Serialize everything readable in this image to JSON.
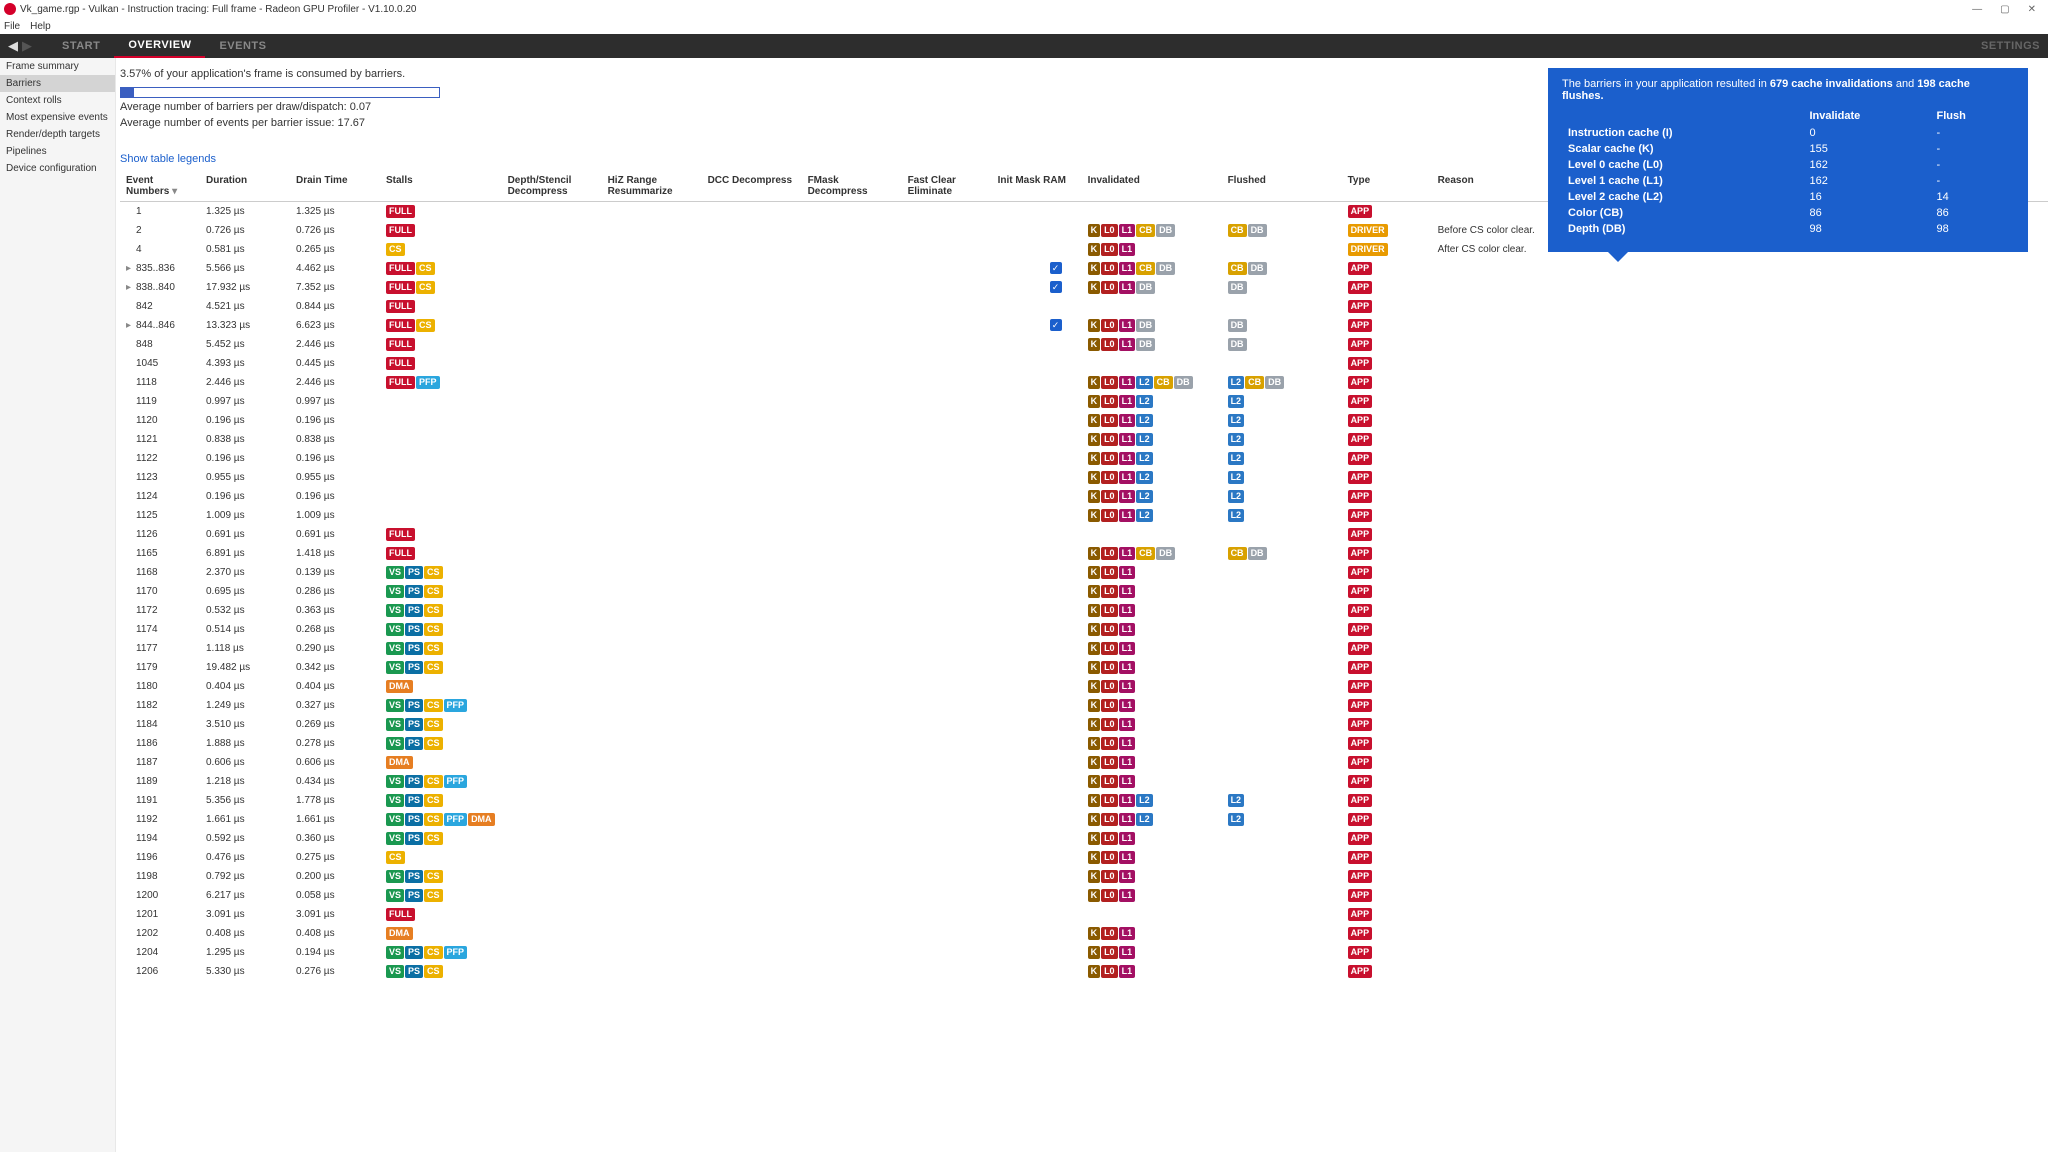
{
  "window": {
    "title": "Vk_game.rgp - Vulkan - Instruction tracing: Full frame - Radeon GPU Profiler - V1.10.0.20"
  },
  "menubar": [
    "File",
    "Help"
  ],
  "navbar": {
    "tabs": [
      "START",
      "OVERVIEW",
      "EVENTS"
    ],
    "active": 1,
    "settings": "SETTINGS"
  },
  "sidebar": {
    "items": [
      "Frame summary",
      "Barriers",
      "Context rolls",
      "Most expensive events",
      "Render/depth targets",
      "Pipelines",
      "Device configuration"
    ],
    "active": 1
  },
  "summary": {
    "line1": "3.57% of your application's frame is consumed by barriers.",
    "line2": "Average number of barriers per draw/dispatch: 0.07",
    "line3": "Average number of events per barrier issue: 17.67"
  },
  "infobox": {
    "intro_a": "The barriers in your application resulted in ",
    "count_inval": "679 cache invalidations",
    "and": " and ",
    "count_flush": "198 cache flushes.",
    "hdr_inval": "Invalidate",
    "hdr_flush": "Flush",
    "rows": [
      {
        "label": "Instruction cache (I)",
        "inval": "0",
        "flush": "-"
      },
      {
        "label": "Scalar cache (K)",
        "inval": "155",
        "flush": "-"
      },
      {
        "label": "Level 0 cache (L0)",
        "inval": "162",
        "flush": "-"
      },
      {
        "label": "Level 1 cache (L1)",
        "inval": "162",
        "flush": "-"
      },
      {
        "label": "Level 2 cache (L2)",
        "inval": "16",
        "flush": "14"
      },
      {
        "label": "Color (CB)",
        "inval": "86",
        "flush": "86"
      },
      {
        "label": "Depth (DB)",
        "inval": "98",
        "flush": "98"
      }
    ]
  },
  "legends": "Show table legends",
  "columns": [
    "Event Numbers",
    "Duration",
    "Drain Time",
    "Stalls",
    "Depth/Stencil Decompress",
    "HiZ Range Resummarize",
    "DCC Decompress",
    "FMask Decompress",
    "Fast Clear Eliminate",
    "Init Mask RAM",
    "Invalidated",
    "Flushed",
    "Type",
    "Reason"
  ],
  "rows": [
    {
      "ev": "1",
      "dur": "1.325 µs",
      "drain": "1.325 µs",
      "stalls": [
        "FULL"
      ],
      "inv": [],
      "flush": [],
      "type": "APP",
      "reason": ""
    },
    {
      "ev": "2",
      "dur": "0.726 µs",
      "drain": "0.726 µs",
      "stalls": [
        "FULL"
      ],
      "inv": [
        "K",
        "L0",
        "L1",
        "CB",
        "DB"
      ],
      "flush": [
        "CB",
        "DB"
      ],
      "type": "DRIVER",
      "reason": "Before CS color clear."
    },
    {
      "ev": "4",
      "dur": "0.581 µs",
      "drain": "0.265 µs",
      "stalls": [
        "CS"
      ],
      "inv": [
        "K",
        "L0",
        "L1"
      ],
      "flush": [],
      "type": "DRIVER",
      "reason": "After CS color clear."
    },
    {
      "ev": "835..836",
      "dur": "5.566 µs",
      "drain": "4.462 µs",
      "stalls": [
        "FULL",
        "CS"
      ],
      "imr": true,
      "inv": [
        "K",
        "L0",
        "L1",
        "CB",
        "DB"
      ],
      "flush": [
        "CB",
        "DB"
      ],
      "type": "APP",
      "reason": "",
      "exp": true
    },
    {
      "ev": "838..840",
      "dur": "17.932 µs",
      "drain": "7.352 µs",
      "stalls": [
        "FULL",
        "CS"
      ],
      "imr": true,
      "inv": [
        "K",
        "L0",
        "L1",
        "DB"
      ],
      "flush": [
        "DB"
      ],
      "type": "APP",
      "reason": "",
      "exp": true
    },
    {
      "ev": "842",
      "dur": "4.521 µs",
      "drain": "0.844 µs",
      "stalls": [
        "FULL"
      ],
      "inv": [],
      "flush": [],
      "type": "APP",
      "reason": ""
    },
    {
      "ev": "844..846",
      "dur": "13.323 µs",
      "drain": "6.623 µs",
      "stalls": [
        "FULL",
        "CS"
      ],
      "imr": true,
      "inv": [
        "K",
        "L0",
        "L1",
        "DB"
      ],
      "flush": [
        "DB"
      ],
      "type": "APP",
      "reason": "",
      "exp": true
    },
    {
      "ev": "848",
      "dur": "5.452 µs",
      "drain": "2.446 µs",
      "stalls": [
        "FULL"
      ],
      "inv": [
        "K",
        "L0",
        "L1",
        "DB"
      ],
      "flush": [
        "DB"
      ],
      "type": "APP",
      "reason": ""
    },
    {
      "ev": "1045",
      "dur": "4.393 µs",
      "drain": "0.445 µs",
      "stalls": [
        "FULL"
      ],
      "inv": [],
      "flush": [],
      "type": "APP",
      "reason": ""
    },
    {
      "ev": "1118",
      "dur": "2.446 µs",
      "drain": "2.446 µs",
      "stalls": [
        "FULL",
        "PFP"
      ],
      "inv": [
        "K",
        "L0",
        "L1",
        "L2",
        "CB",
        "DB"
      ],
      "flush": [
        "L2",
        "CB",
        "DB"
      ],
      "type": "APP",
      "reason": ""
    },
    {
      "ev": "1119",
      "dur": "0.997 µs",
      "drain": "0.997 µs",
      "stalls": [],
      "inv": [
        "K",
        "L0",
        "L1",
        "L2"
      ],
      "flush": [
        "L2"
      ],
      "type": "APP",
      "reason": ""
    },
    {
      "ev": "1120",
      "dur": "0.196 µs",
      "drain": "0.196 µs",
      "stalls": [],
      "inv": [
        "K",
        "L0",
        "L1",
        "L2"
      ],
      "flush": [
        "L2"
      ],
      "type": "APP",
      "reason": ""
    },
    {
      "ev": "1121",
      "dur": "0.838 µs",
      "drain": "0.838 µs",
      "stalls": [],
      "inv": [
        "K",
        "L0",
        "L1",
        "L2"
      ],
      "flush": [
        "L2"
      ],
      "type": "APP",
      "reason": ""
    },
    {
      "ev": "1122",
      "dur": "0.196 µs",
      "drain": "0.196 µs",
      "stalls": [],
      "inv": [
        "K",
        "L0",
        "L1",
        "L2"
      ],
      "flush": [
        "L2"
      ],
      "type": "APP",
      "reason": ""
    },
    {
      "ev": "1123",
      "dur": "0.955 µs",
      "drain": "0.955 µs",
      "stalls": [],
      "inv": [
        "K",
        "L0",
        "L1",
        "L2"
      ],
      "flush": [
        "L2"
      ],
      "type": "APP",
      "reason": ""
    },
    {
      "ev": "1124",
      "dur": "0.196 µs",
      "drain": "0.196 µs",
      "stalls": [],
      "inv": [
        "K",
        "L0",
        "L1",
        "L2"
      ],
      "flush": [
        "L2"
      ],
      "type": "APP",
      "reason": ""
    },
    {
      "ev": "1125",
      "dur": "1.009 µs",
      "drain": "1.009 µs",
      "stalls": [],
      "inv": [
        "K",
        "L0",
        "L1",
        "L2"
      ],
      "flush": [
        "L2"
      ],
      "type": "APP",
      "reason": ""
    },
    {
      "ev": "1126",
      "dur": "0.691 µs",
      "drain": "0.691 µs",
      "stalls": [
        "FULL"
      ],
      "inv": [],
      "flush": [],
      "type": "APP",
      "reason": ""
    },
    {
      "ev": "1165",
      "dur": "6.891 µs",
      "drain": "1.418 µs",
      "stalls": [
        "FULL"
      ],
      "inv": [
        "K",
        "L0",
        "L1",
        "CB",
        "DB"
      ],
      "flush": [
        "CB",
        "DB"
      ],
      "type": "APP",
      "reason": ""
    },
    {
      "ev": "1168",
      "dur": "2.370 µs",
      "drain": "0.139 µs",
      "stalls": [
        "VS",
        "PS",
        "CS"
      ],
      "inv": [
        "K",
        "L0",
        "L1"
      ],
      "flush": [],
      "type": "APP",
      "reason": ""
    },
    {
      "ev": "1170",
      "dur": "0.695 µs",
      "drain": "0.286 µs",
      "stalls": [
        "VS",
        "PS",
        "CS"
      ],
      "inv": [
        "K",
        "L0",
        "L1"
      ],
      "flush": [],
      "type": "APP",
      "reason": ""
    },
    {
      "ev": "1172",
      "dur": "0.532 µs",
      "drain": "0.363 µs",
      "stalls": [
        "VS",
        "PS",
        "CS"
      ],
      "inv": [
        "K",
        "L0",
        "L1"
      ],
      "flush": [],
      "type": "APP",
      "reason": ""
    },
    {
      "ev": "1174",
      "dur": "0.514 µs",
      "drain": "0.268 µs",
      "stalls": [
        "VS",
        "PS",
        "CS"
      ],
      "inv": [
        "K",
        "L0",
        "L1"
      ],
      "flush": [],
      "type": "APP",
      "reason": ""
    },
    {
      "ev": "1177",
      "dur": "1.118 µs",
      "drain": "0.290 µs",
      "stalls": [
        "VS",
        "PS",
        "CS"
      ],
      "inv": [
        "K",
        "L0",
        "L1"
      ],
      "flush": [],
      "type": "APP",
      "reason": ""
    },
    {
      "ev": "1179",
      "dur": "19.482 µs",
      "drain": "0.342 µs",
      "stalls": [
        "VS",
        "PS",
        "CS"
      ],
      "inv": [
        "K",
        "L0",
        "L1"
      ],
      "flush": [],
      "type": "APP",
      "reason": ""
    },
    {
      "ev": "1180",
      "dur": "0.404 µs",
      "drain": "0.404 µs",
      "stalls": [
        "DMA"
      ],
      "inv": [
        "K",
        "L0",
        "L1"
      ],
      "flush": [],
      "type": "APP",
      "reason": ""
    },
    {
      "ev": "1182",
      "dur": "1.249 µs",
      "drain": "0.327 µs",
      "stalls": [
        "VS",
        "PS",
        "CS",
        "PFP"
      ],
      "inv": [
        "K",
        "L0",
        "L1"
      ],
      "flush": [],
      "type": "APP",
      "reason": ""
    },
    {
      "ev": "1184",
      "dur": "3.510 µs",
      "drain": "0.269 µs",
      "stalls": [
        "VS",
        "PS",
        "CS"
      ],
      "inv": [
        "K",
        "L0",
        "L1"
      ],
      "flush": [],
      "type": "APP",
      "reason": ""
    },
    {
      "ev": "1186",
      "dur": "1.888 µs",
      "drain": "0.278 µs",
      "stalls": [
        "VS",
        "PS",
        "CS"
      ],
      "inv": [
        "K",
        "L0",
        "L1"
      ],
      "flush": [],
      "type": "APP",
      "reason": ""
    },
    {
      "ev": "1187",
      "dur": "0.606 µs",
      "drain": "0.606 µs",
      "stalls": [
        "DMA"
      ],
      "inv": [
        "K",
        "L0",
        "L1"
      ],
      "flush": [],
      "type": "APP",
      "reason": ""
    },
    {
      "ev": "1189",
      "dur": "1.218 µs",
      "drain": "0.434 µs",
      "stalls": [
        "VS",
        "PS",
        "CS",
        "PFP"
      ],
      "inv": [
        "K",
        "L0",
        "L1"
      ],
      "flush": [],
      "type": "APP",
      "reason": ""
    },
    {
      "ev": "1191",
      "dur": "5.356 µs",
      "drain": "1.778 µs",
      "stalls": [
        "VS",
        "PS",
        "CS"
      ],
      "inv": [
        "K",
        "L0",
        "L1",
        "L2"
      ],
      "flush": [
        "L2"
      ],
      "type": "APP",
      "reason": ""
    },
    {
      "ev": "1192",
      "dur": "1.661 µs",
      "drain": "1.661 µs",
      "stalls": [
        "VS",
        "PS",
        "CS",
        "PFP",
        "DMA"
      ],
      "inv": [
        "K",
        "L0",
        "L1",
        "L2"
      ],
      "flush": [
        "L2"
      ],
      "type": "APP",
      "reason": ""
    },
    {
      "ev": "1194",
      "dur": "0.592 µs",
      "drain": "0.360 µs",
      "stalls": [
        "VS",
        "PS",
        "CS"
      ],
      "inv": [
        "K",
        "L0",
        "L1"
      ],
      "flush": [],
      "type": "APP",
      "reason": ""
    },
    {
      "ev": "1196",
      "dur": "0.476 µs",
      "drain": "0.275 µs",
      "stalls": [
        "CS"
      ],
      "inv": [
        "K",
        "L0",
        "L1"
      ],
      "flush": [],
      "type": "APP",
      "reason": ""
    },
    {
      "ev": "1198",
      "dur": "0.792 µs",
      "drain": "0.200 µs",
      "stalls": [
        "VS",
        "PS",
        "CS"
      ],
      "inv": [
        "K",
        "L0",
        "L1"
      ],
      "flush": [],
      "type": "APP",
      "reason": ""
    },
    {
      "ev": "1200",
      "dur": "6.217 µs",
      "drain": "0.058 µs",
      "stalls": [
        "VS",
        "PS",
        "CS"
      ],
      "inv": [
        "K",
        "L0",
        "L1"
      ],
      "flush": [],
      "type": "APP",
      "reason": ""
    },
    {
      "ev": "1201",
      "dur": "3.091 µs",
      "drain": "3.091 µs",
      "stalls": [
        "FULL"
      ],
      "inv": [],
      "flush": [],
      "type": "APP",
      "reason": ""
    },
    {
      "ev": "1202",
      "dur": "0.408 µs",
      "drain": "0.408 µs",
      "stalls": [
        "DMA"
      ],
      "inv": [
        "K",
        "L0",
        "L1"
      ],
      "flush": [],
      "type": "APP",
      "reason": ""
    },
    {
      "ev": "1204",
      "dur": "1.295 µs",
      "drain": "0.194 µs",
      "stalls": [
        "VS",
        "PS",
        "CS",
        "PFP"
      ],
      "inv": [
        "K",
        "L0",
        "L1"
      ],
      "flush": [],
      "type": "APP",
      "reason": ""
    },
    {
      "ev": "1206",
      "dur": "5.330 µs",
      "drain": "0.276 µs",
      "stalls": [
        "VS",
        "PS",
        "CS"
      ],
      "inv": [
        "K",
        "L0",
        "L1"
      ],
      "flush": [],
      "type": "APP",
      "reason": ""
    }
  ]
}
